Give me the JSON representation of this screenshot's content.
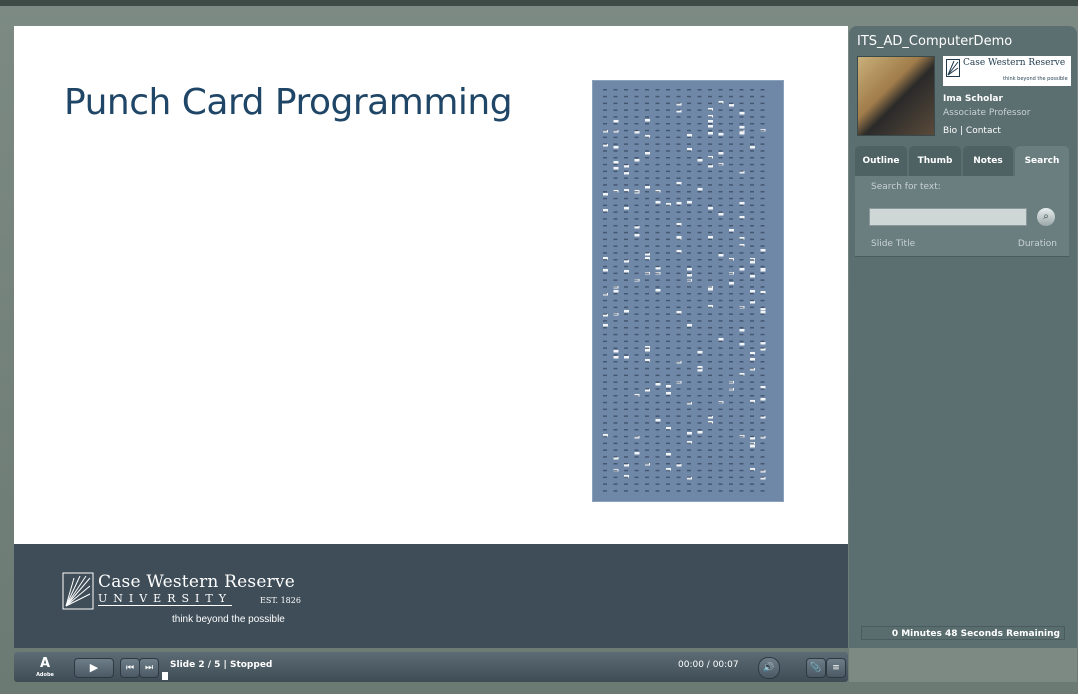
{
  "slide": {
    "title": "Punch Card Programming",
    "footer": {
      "logo_name": "Case Western Reserve",
      "logo_university": "UNIVERSITY",
      "logo_est": "EST. 1826",
      "logo_tagline": "think beyond the possible"
    }
  },
  "controls": {
    "adobe_label": "Adobe",
    "play_glyph": "▶",
    "prev_glyph": "⏮",
    "next_glyph": "⏭",
    "slide_status": "Slide 2 / 5 | Stopped",
    "time": "00:00 / 00:07",
    "volume_glyph": "🔊",
    "attach_glyph": "📎",
    "menu_glyph": "≡"
  },
  "panel": {
    "title": "ITS_AD_ComputerDemo",
    "mini_logo_name": "Case Western Reserve",
    "mini_logo_tag": "think beyond the possible",
    "presenter": {
      "name": "Ima Scholar",
      "role": "Associate Professor",
      "links": "Bio | Contact"
    },
    "tabs": [
      "Outline",
      "Thumb",
      "Notes",
      "Search"
    ],
    "active_tab": "Search",
    "search": {
      "label": "Search for text:",
      "value": "",
      "placeholder": "",
      "button_glyph": "⌕",
      "col_title": "Slide Title",
      "col_duration": "Duration"
    },
    "remaining": "0 Minutes 48 Seconds Remaining"
  },
  "colors": {
    "slide_title": "#1f4666",
    "footer_bg": "#3e4d58",
    "panel_bg": "#5b6e70",
    "punch_card": "#6f87a7"
  }
}
